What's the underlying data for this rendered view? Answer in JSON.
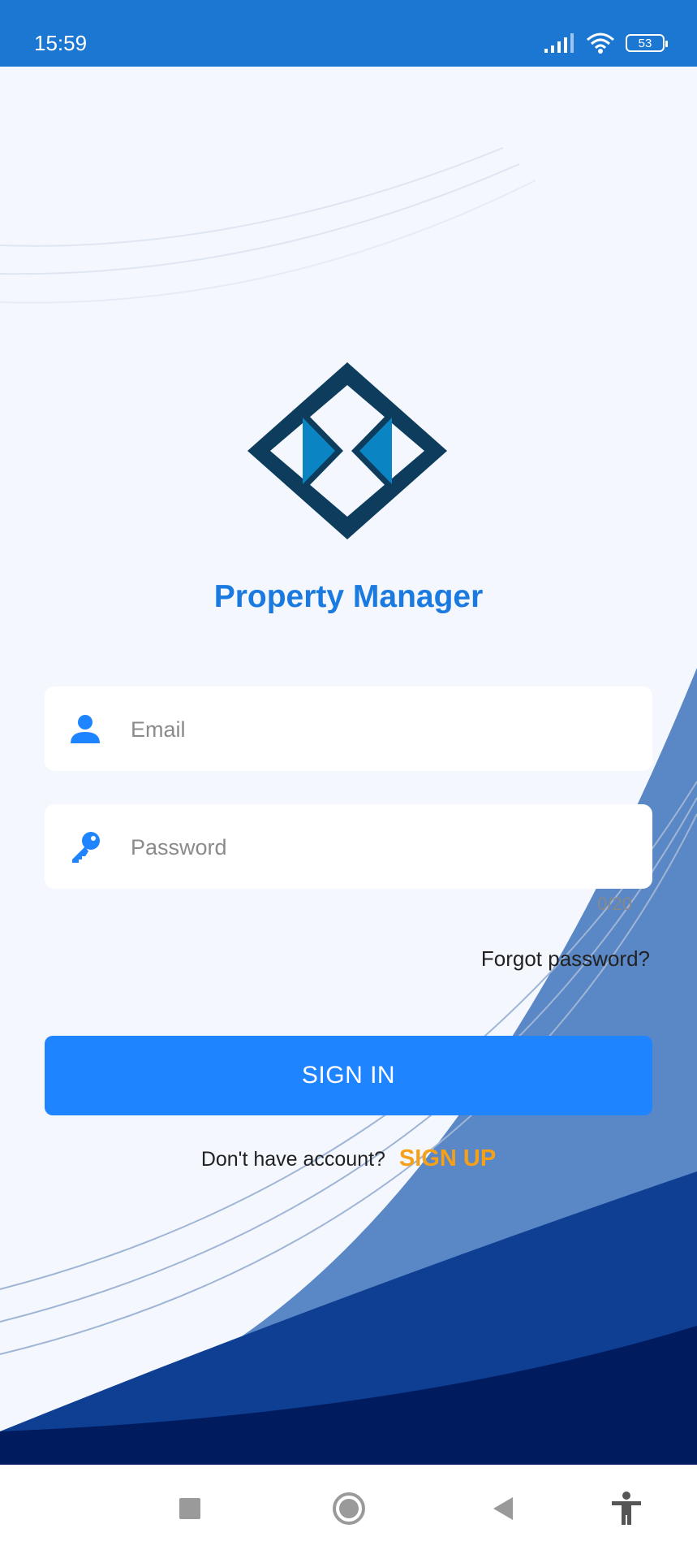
{
  "status_bar": {
    "time": "15:59",
    "battery": "53",
    "icons": [
      "signal-icon",
      "wifi-icon",
      "battery-icon"
    ]
  },
  "app": {
    "title": "Property Manager",
    "logo": "diamond-key-logo"
  },
  "form": {
    "email_placeholder": "Email",
    "email_value": "",
    "password_placeholder": "Password",
    "password_value": "",
    "password_counter": "0/20",
    "forgot_label": "Forgot password?",
    "signin_label": "SIGN IN",
    "no_account_text": "Don't have account?",
    "signup_label": "SIGN UP"
  },
  "nav": {
    "items": [
      "recents-icon",
      "home-icon",
      "back-icon",
      "accessibility-icon"
    ]
  },
  "colors": {
    "status_bar": "#1b77d2",
    "title": "#1b7ae0",
    "primary_button": "#1f84ff",
    "signup": "#f6a01a",
    "wave_light": "#5a87c6",
    "wave_mid": "#0e3f93",
    "wave_dark": "#001b5e"
  }
}
